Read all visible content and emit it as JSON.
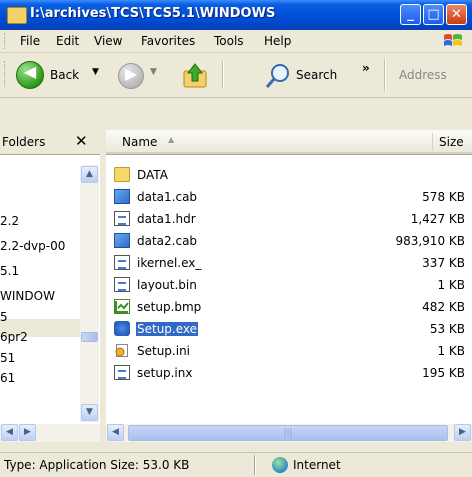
{
  "window": {
    "title": "I:\\archives\\TCS\\TCS5.1\\WINDOWS",
    "minimize": "_",
    "maximize": "□",
    "close": "✕"
  },
  "menu": {
    "items": [
      "File",
      "Edit",
      "View",
      "Favorites",
      "Tools",
      "Help"
    ]
  },
  "toolbar": {
    "back_label": "Back",
    "search_label": "Search",
    "chevron": "»",
    "address_label": "Address"
  },
  "folders": {
    "title": "Folders",
    "close": "✕",
    "tree": [
      "2.2",
      "2.2-dvp-00",
      "5.1",
      "WINDOW",
      "5",
      "6pr2",
      "51",
      "61"
    ]
  },
  "list": {
    "columns": {
      "name": "Name",
      "size": "Size"
    },
    "files": [
      {
        "name": "DATA",
        "size": "",
        "icon": "folder-icon"
      },
      {
        "name": "data1.cab",
        "size": "578 KB",
        "icon": "cab-file-icon"
      },
      {
        "name": "data1.hdr",
        "size": "1,427 KB",
        "icon": "document-icon"
      },
      {
        "name": "data2.cab",
        "size": "983,910 KB",
        "icon": "cab-file-icon"
      },
      {
        "name": "ikernel.ex_",
        "size": "337 KB",
        "icon": "document-icon"
      },
      {
        "name": "layout.bin",
        "size": "1 KB",
        "icon": "document-icon"
      },
      {
        "name": "setup.bmp",
        "size": "482 KB",
        "icon": "bitmap-icon"
      },
      {
        "name": "Setup.exe",
        "size": "53 KB",
        "icon": "setup-exe-icon",
        "selected": true
      },
      {
        "name": "Setup.ini",
        "size": "1 KB",
        "icon": "settings-file-icon"
      },
      {
        "name": "setup.inx",
        "size": "195 KB",
        "icon": "document-icon"
      }
    ]
  },
  "status": {
    "text": "Type: Application Size: 53.0 KB",
    "zone": "Internet"
  },
  "colors": {
    "titlebar": "#0050d8",
    "selection": "#316ac5",
    "chrome": "#ece9d8"
  }
}
